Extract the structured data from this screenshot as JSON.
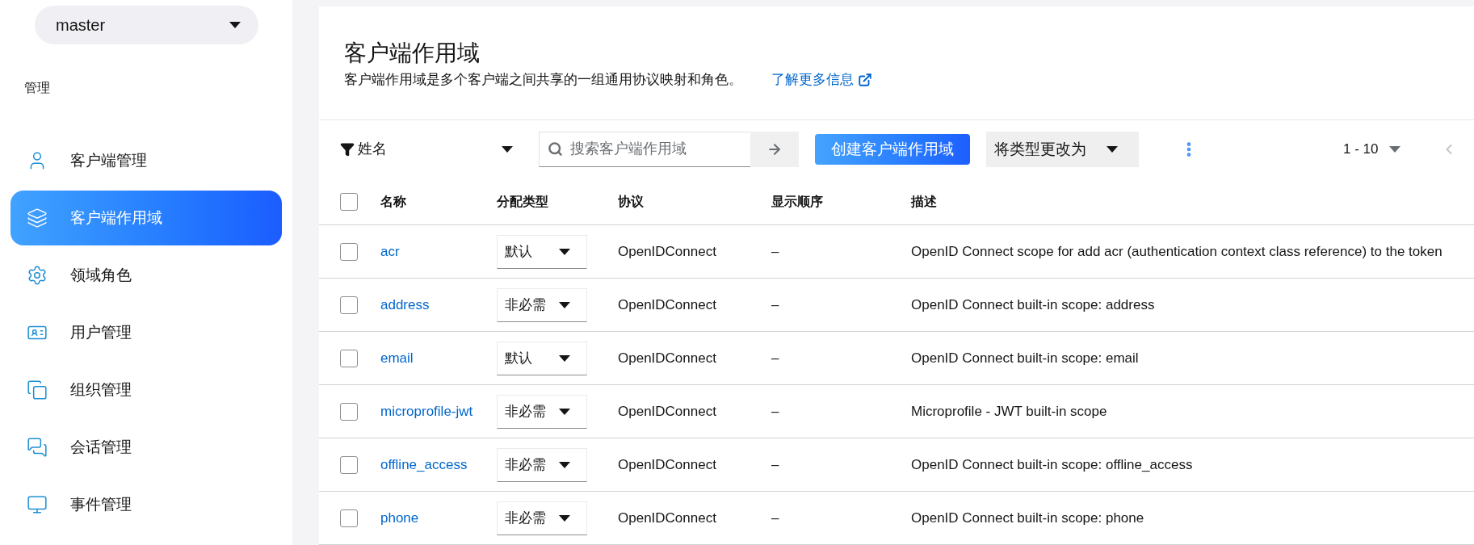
{
  "sidebar": {
    "realm_selector": "master",
    "section": "管理",
    "items": [
      {
        "label": "客户端管理",
        "selected": false
      },
      {
        "label": "客户端作用域",
        "selected": true
      },
      {
        "label": "领域角色",
        "selected": false
      },
      {
        "label": "用户管理",
        "selected": false
      },
      {
        "label": "组织管理",
        "selected": false
      },
      {
        "label": "会话管理",
        "selected": false
      },
      {
        "label": "事件管理",
        "selected": false
      }
    ]
  },
  "header": {
    "title": "客户端作用域",
    "description": "客户端作用域是多个客户端之间共享的一组通用协议映射和角色。",
    "learn_more": "了解更多信息"
  },
  "toolbar": {
    "filter": "姓名",
    "search": {
      "placeholder": "搜索客户端作用域"
    },
    "create_button": "创建客户端作用域",
    "change_type": "将类型更改为",
    "pagination": "1 - 10"
  },
  "table": {
    "columns": [
      "名称",
      "分配类型",
      "协议",
      "显示顺序",
      "描述"
    ],
    "all_checked": false,
    "rows": [
      {
        "checked": false,
        "name": "acr",
        "type": "默认",
        "protocol": "OpenIDConnect",
        "order": "–",
        "description": "OpenID Connect scope for add acr (authentication context class reference) to the token"
      },
      {
        "checked": false,
        "name": "address",
        "type": "非必需",
        "protocol": "OpenIDConnect",
        "order": "–",
        "description": "OpenID Connect built-in scope: address"
      },
      {
        "checked": false,
        "name": "email",
        "type": "默认",
        "protocol": "OpenIDConnect",
        "order": "–",
        "description": "OpenID Connect built-in scope: email"
      },
      {
        "checked": false,
        "name": "microprofile-jwt",
        "type": "非必需",
        "protocol": "OpenIDConnect",
        "order": "–",
        "description": "Microprofile - JWT built-in scope"
      },
      {
        "checked": false,
        "name": "offline_access",
        "type": "非必需",
        "protocol": "OpenIDConnect",
        "order": "–",
        "description": "OpenID Connect built-in scope: offline_access"
      },
      {
        "checked": false,
        "name": "phone",
        "type": "非必需",
        "protocol": "OpenIDConnect",
        "order": "–",
        "description": "OpenID Connect built-in scope: phone"
      }
    ]
  }
}
